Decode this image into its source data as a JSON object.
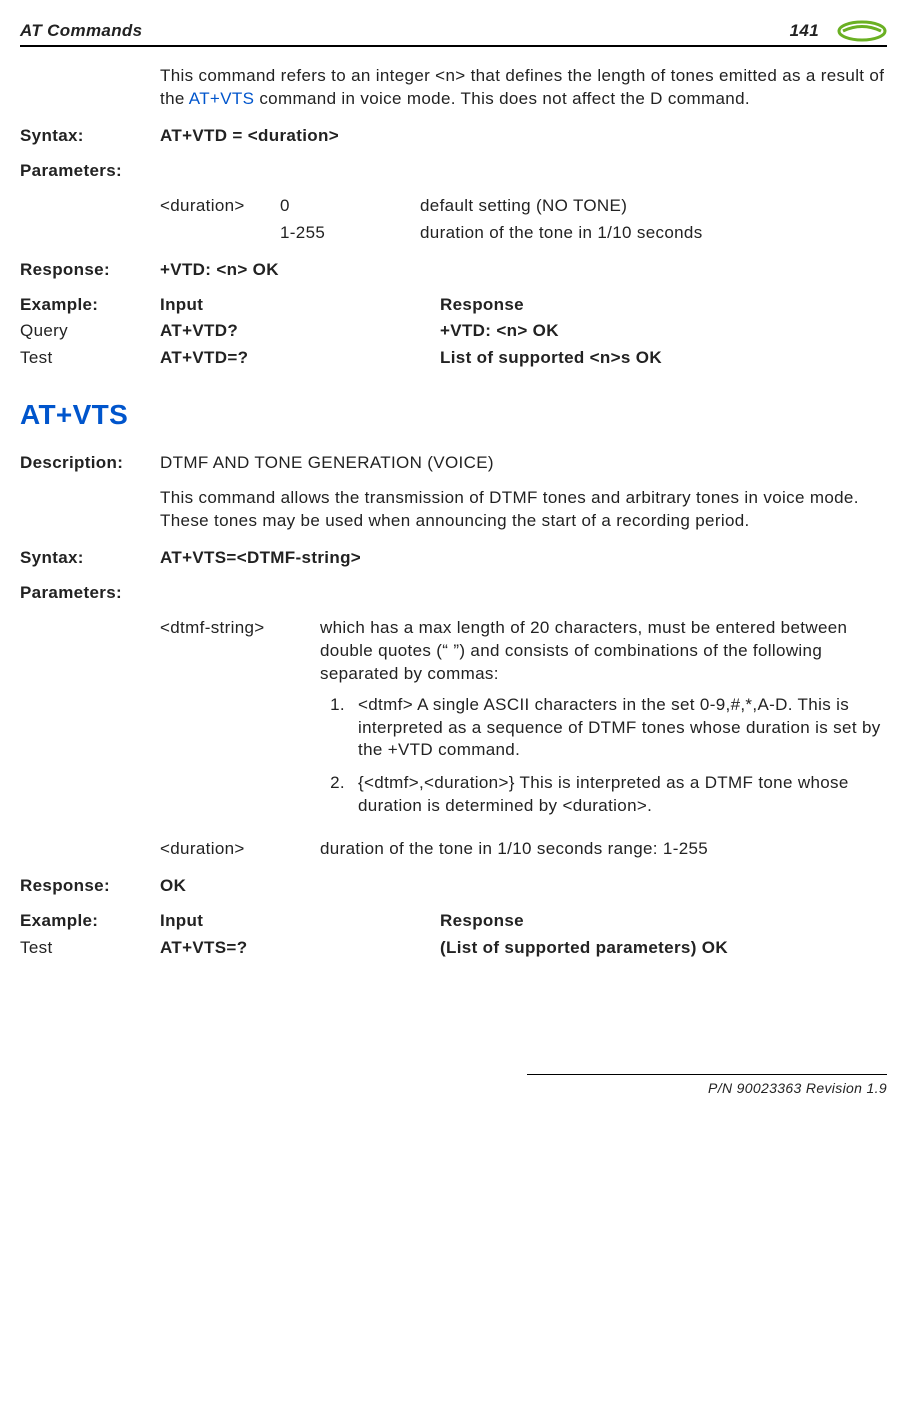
{
  "header": {
    "title": "AT Commands",
    "page": "141"
  },
  "vtd": {
    "intro_pre": "This command refers to an integer <n> that defines the length of tones emitted as a result of the ",
    "intro_link": "AT+VTS",
    "intro_post": " command in voice mode. This does not affect the D command.",
    "syntax_label": "Syntax:",
    "syntax_value": "AT+VTD = <duration>",
    "params_label": "Parameters:",
    "param_name": "<duration>",
    "param_v1": "0",
    "param_d1": "default setting (NO TONE)",
    "param_v2": "1-255",
    "param_d2": "duration of the tone in 1/10 seconds",
    "response_label": "Response:",
    "response_value": "+VTD: <n> OK",
    "example_label": "Example:",
    "col_input": "Input",
    "col_response": "Response",
    "row1_a": "Query",
    "row1_b": "AT+VTD?",
    "row1_c": "+VTD: <n> OK",
    "row2_a": "Test",
    "row2_b": "AT+VTD=?",
    "row2_c": "List of supported <n>s OK"
  },
  "vts": {
    "heading": "AT+VTS",
    "desc_label": "Description:",
    "desc_title": "DTMF AND TONE GENERATION (VOICE)",
    "desc_body": "This command allows the transmission of DTMF tones and arbitrary tones in voice mode. These tones may be used when announcing the start of a recording period.",
    "syntax_label": "Syntax:",
    "syntax_value": "AT+VTS=<DTMF-string>",
    "params_label": "Parameters:",
    "p1_name": "<dtmf-string>",
    "p1_desc": "which has a max length of 20 characters, must be entered between double quotes (“ ”) and consists of combinations of the following separated by commas:",
    "li1": "<dtmf> A single ASCII characters in the set 0-9,#,*,A-D. This is interpreted as a sequence of DTMF tones whose duration is set by the +VTD command.",
    "li2": "{<dtmf>,<duration>} This is interpreted as a DTMF tone whose duration is determined by <duration>.",
    "p2_name": "<duration>",
    "p2_desc": "duration of the tone in 1/10 seconds range: 1-255",
    "response_label": "Response:",
    "response_value": "OK",
    "example_label": "Example:",
    "col_input": "Input",
    "col_response": "Response",
    "row1_a": "Test",
    "row1_b": "AT+VTS=?",
    "row1_c": "(List of supported parameters) OK"
  },
  "footer": "P/N 90023363  Revision 1.9"
}
